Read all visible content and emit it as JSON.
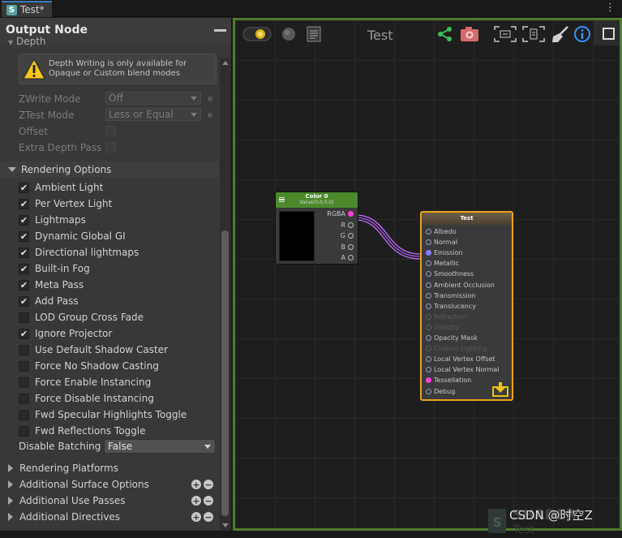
{
  "window": {
    "tab_title": "Test*",
    "tab_icon": "shader-s-icon"
  },
  "panel": {
    "title": "Output Node",
    "depth_label": "Depth",
    "warning": "Depth Writing is only available for Opaque or Custom blend modes",
    "zwrite": {
      "label": "ZWrite Mode",
      "value": "Off"
    },
    "ztest": {
      "label": "ZTest Mode",
      "value": "Less or Equal"
    },
    "offset_label": "Offset",
    "extra_depth_label": "Extra Depth Pass",
    "rendering_options": {
      "title": "Rendering Options",
      "items": [
        {
          "label": "Ambient Light",
          "checked": true
        },
        {
          "label": "Per Vertex Light",
          "checked": true
        },
        {
          "label": "Lightmaps",
          "checked": true
        },
        {
          "label": "Dynamic Global GI",
          "checked": true
        },
        {
          "label": "Directional lightmaps",
          "checked": true
        },
        {
          "label": "Built-in Fog",
          "checked": true
        },
        {
          "label": "Meta Pass",
          "checked": true
        },
        {
          "label": "Add Pass",
          "checked": true
        },
        {
          "label": "LOD Group Cross Fade",
          "checked": false
        },
        {
          "label": "Ignore Projector",
          "checked": true
        },
        {
          "label": "Use Default Shadow Caster",
          "checked": false
        },
        {
          "label": "Force No Shadow Casting",
          "checked": false
        },
        {
          "label": "Force Enable Instancing",
          "checked": false
        },
        {
          "label": "Force Disable Instancing",
          "checked": false
        },
        {
          "label": "Fwd Specular Highlights Toggle",
          "checked": false
        },
        {
          "label": "Fwd Reflections Toggle",
          "checked": false
        }
      ],
      "disable_batching": {
        "label": "Disable Batching",
        "value": "False"
      }
    },
    "collapsed_sections": [
      {
        "label": "Rendering Platforms",
        "has_plus_minus": false
      },
      {
        "label": "Additional Surface Options",
        "has_plus_minus": true
      },
      {
        "label": "Additional Use Passes",
        "has_plus_minus": true
      },
      {
        "label": "Additional Directives",
        "has_plus_minus": true
      }
    ]
  },
  "canvas": {
    "title": "Test",
    "accent_border": "#4f7a2e",
    "color_node": {
      "title": "Color 0",
      "subtitle": "Value(0,0,0,0)",
      "outputs": [
        "RGBA",
        "R",
        "G",
        "B",
        "A"
      ]
    },
    "output_node": {
      "title": "Test",
      "inputs": [
        {
          "label": "Albedo",
          "state": "normal"
        },
        {
          "label": "Normal",
          "state": "normal"
        },
        {
          "label": "Emission",
          "state": "connected"
        },
        {
          "label": "Metallic",
          "state": "normal"
        },
        {
          "label": "Smoothness",
          "state": "normal"
        },
        {
          "label": "Ambient Occlusion",
          "state": "normal"
        },
        {
          "label": "Transmission",
          "state": "normal"
        },
        {
          "label": "Translucency",
          "state": "normal"
        },
        {
          "label": "Refraction",
          "state": "disabled"
        },
        {
          "label": "Opacity",
          "state": "disabled"
        },
        {
          "label": "Opacity Mask",
          "state": "normal"
        },
        {
          "label": "Custom Lighting",
          "state": "disabled"
        },
        {
          "label": "Local Vertex Offset",
          "state": "normal"
        },
        {
          "label": "Local Vertex Normal",
          "state": "normal"
        },
        {
          "label": "Tessellation",
          "state": "magenta"
        },
        {
          "label": "Debug",
          "state": "normal"
        }
      ]
    },
    "watermark": {
      "line1": "SHADER",
      "line2": "Test"
    },
    "credit": "CSDN @时空Z"
  }
}
